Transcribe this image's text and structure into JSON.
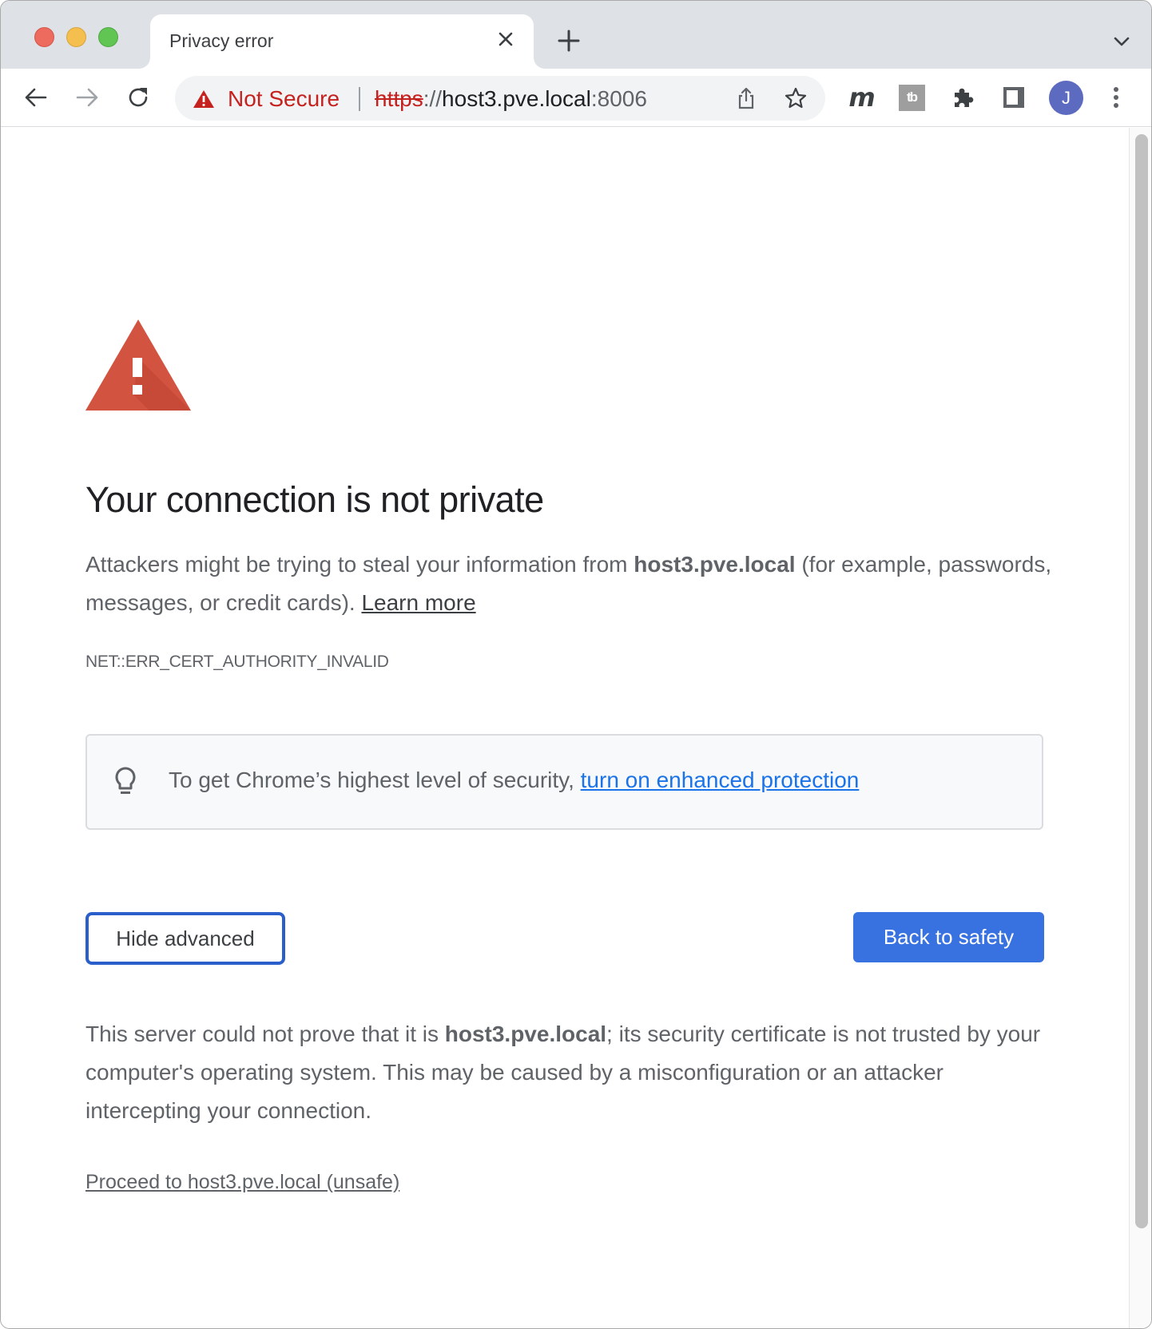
{
  "window": {
    "traffic_lights": [
      "close",
      "minimize",
      "maximize"
    ]
  },
  "tab": {
    "title": "Privacy error",
    "close_icon": "close-icon",
    "new_tab_icon": "plus-icon",
    "tab_search_icon": "chevron-down-icon"
  },
  "toolbar": {
    "back_icon": "arrow-left-icon",
    "forward_icon": "arrow-right-icon",
    "reload_icon": "reload-icon",
    "omnibox": {
      "security_label": "Not Secure",
      "url_scheme": "https",
      "url_separator": "://",
      "url_host": "host3.pve.local",
      "url_port": ":8006",
      "share_icon": "share-icon",
      "bookmark_icon": "star-icon"
    },
    "extensions": [
      {
        "name": "m-extension",
        "glyph": "m"
      },
      {
        "name": "tb-extension",
        "glyph": "tb"
      },
      {
        "name": "extensions-puzzle",
        "glyph": "puzzle-icon"
      },
      {
        "name": "side-panel",
        "glyph": "side-panel-icon"
      }
    ],
    "profile_initial": "J",
    "menu_icon": "vertical-dots-icon"
  },
  "page": {
    "heading": "Your connection is not private",
    "intro_part1": "Attackers might be trying to steal your information from ",
    "intro_host": "host3.pve.local",
    "intro_part2": " (for example, passwords, messages, or credit cards). ",
    "learn_more": "Learn more",
    "error_code": "NET::ERR_CERT_AUTHORITY_INVALID",
    "info_box": {
      "text": "To get Chrome’s highest level of security, ",
      "link": "turn on enhanced protection"
    },
    "hide_advanced_button": "Hide advanced",
    "back_to_safety_button": "Back to safety",
    "details_part1": "This server could not prove that it is ",
    "details_host": "host3.pve.local",
    "details_part2": "; its security certificate is not trusted by your computer's operating system. This may be caused by a misconfiguration or an attacker intercepting your connection.",
    "proceed_link": "Proceed to host3.pve.local (unsafe)"
  },
  "colors": {
    "danger_red": "#c5221f",
    "triangle_red": "#d35341",
    "primary_blue": "#3871e0",
    "link_blue": "#1a73e8",
    "avatar_bg": "#5c6bc0"
  }
}
